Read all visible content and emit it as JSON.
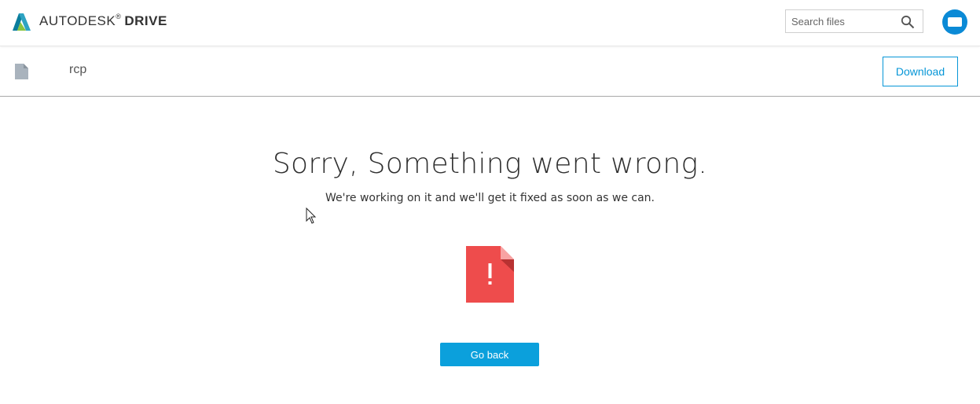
{
  "header": {
    "brand_name": "AUTODESK",
    "brand_mark": "®",
    "product_name": "DRIVE",
    "logo_icon": "autodesk-a-logo-icon",
    "search": {
      "placeholder": "Search files",
      "value": "",
      "icon": "search-icon"
    },
    "avatar_icon": "user-avatar-icon",
    "colors": {
      "avatar": "#0b8ad6"
    }
  },
  "file_bar": {
    "file_icon": "document-icon",
    "file_name": "rcp",
    "download_label": "Download"
  },
  "error": {
    "title": "Sorry, Something went wrong.",
    "message": "We're working on it and we'll get it fixed as soon as we can.",
    "icon": "error-document-icon",
    "go_back_label": "Go back",
    "colors": {
      "error_icon": "#ee4c4c",
      "button": "#0ba0dc"
    }
  }
}
